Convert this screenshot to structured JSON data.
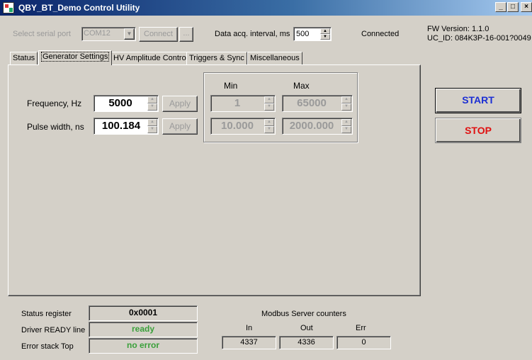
{
  "window": {
    "title": "QBY_BT_Demo Control Utility",
    "buttons": {
      "minimize": "_",
      "maximize": "□",
      "close": "×"
    }
  },
  "top": {
    "serial_port_label": "Select serial port",
    "serial_port_value": "COM12",
    "connect_button": "Connect",
    "browse_button": "...",
    "interval_label": "Data acq. interval, ms",
    "interval_value": "500",
    "connection_status": "Connected",
    "fw_version": "FW Version: 1.1.0",
    "uc_id": "UC_ID: 084K3P-16-001?0049"
  },
  "tabs": [
    {
      "label": "Status",
      "active": false
    },
    {
      "label": "Generator Settings",
      "active": true
    },
    {
      "label": "HV Amplitude Control",
      "active": false
    },
    {
      "label": "Triggers & Sync",
      "active": false
    },
    {
      "label": "Miscellaneous",
      "active": false
    }
  ],
  "generator": {
    "min_header": "Min",
    "max_header": "Max",
    "frequency": {
      "label": "Frequency, Hz",
      "value": "5000",
      "apply": "Apply",
      "min": "1",
      "max": "65000"
    },
    "pulse_width": {
      "label": "Pulse width, ns",
      "value": "100.184",
      "apply": "Apply",
      "min": "10.000",
      "max": "2000.000"
    }
  },
  "actions": {
    "start": "START",
    "stop": "STOP",
    "start_color": "#1c2fd4",
    "stop_color": "#e01010"
  },
  "bottom": {
    "status_register_label": "Status register",
    "status_register_value": "0x0001",
    "driver_ready_label": "Driver READY line",
    "driver_ready_value": "ready",
    "error_stack_label": "Error stack Top",
    "error_stack_value": "no error",
    "ok_color": "#3aa03a",
    "modbus_title": "Modbus Server counters",
    "counters": [
      {
        "label": "In",
        "value": "4337"
      },
      {
        "label": "Out",
        "value": "4336"
      },
      {
        "label": "Err",
        "value": "0"
      }
    ]
  }
}
